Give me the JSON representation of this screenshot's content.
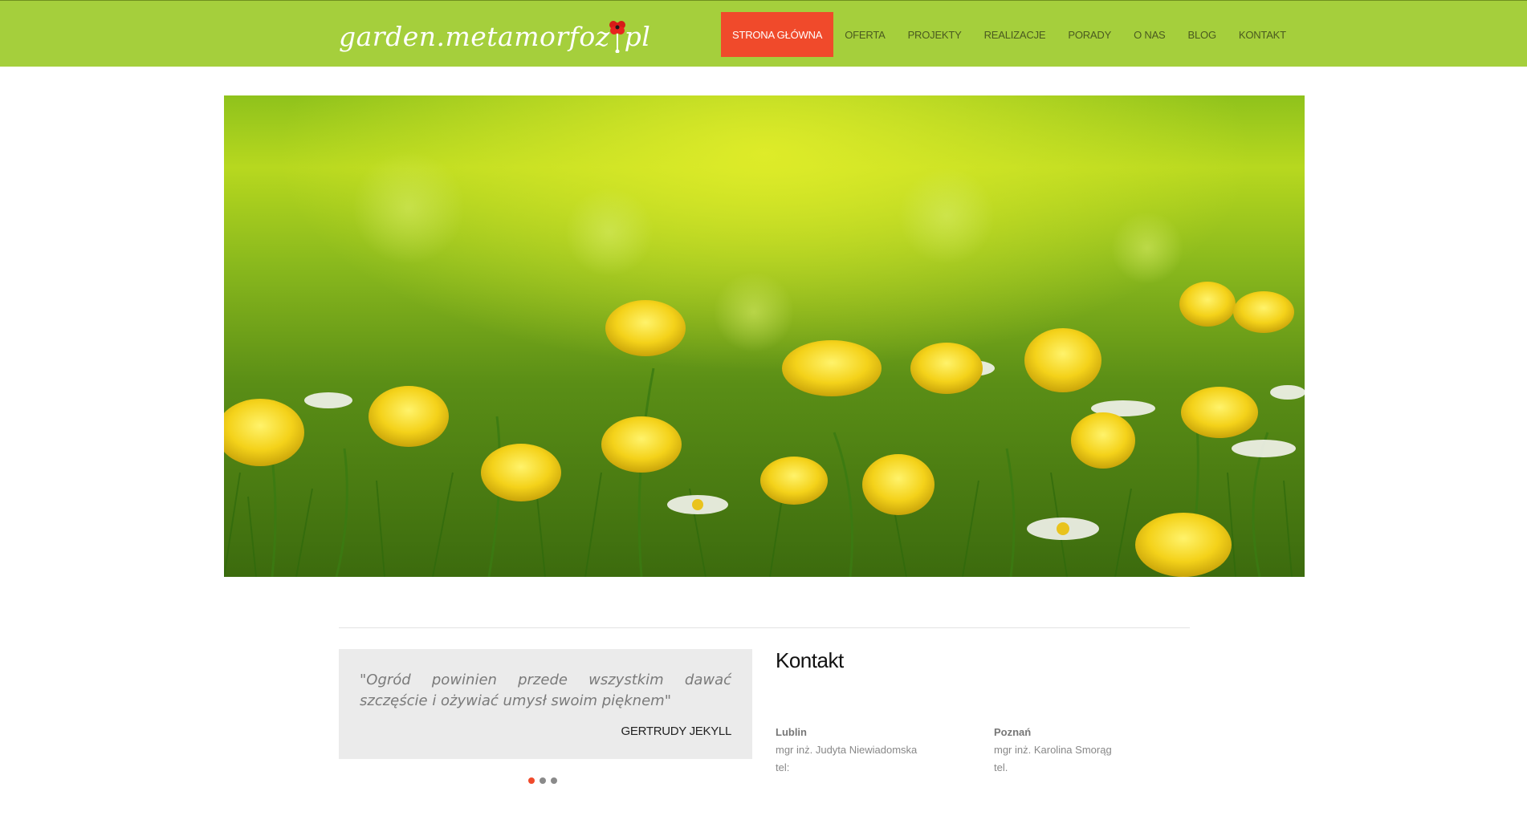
{
  "header": {
    "logo_text_before": "garden.metamorfoz",
    "logo_text_after": "pl",
    "bg_color": "#a5cf3c",
    "accent_color": "#f04a2b"
  },
  "nav": {
    "items": [
      {
        "label": "STRONA GŁÓWNA",
        "active": true
      },
      {
        "label": "OFERTA"
      },
      {
        "label": "PROJEKTY"
      },
      {
        "label": "REALIZACJE"
      },
      {
        "label": "PORADY"
      },
      {
        "label": "O NAS"
      },
      {
        "label": "BLOG"
      },
      {
        "label": "KONTAKT"
      }
    ]
  },
  "quote": {
    "text": "\"Ogród powinien przede wszystkim dawać szczęście i ożywiać umysł swoim pięknem\"",
    "author": "GERTRUDY JEKYLL",
    "slides": 3,
    "active_slide": 1
  },
  "contact": {
    "title": "Kontakt",
    "offices": [
      {
        "city": "Lublin",
        "person": "mgr inż. Judyta Niewiadomska",
        "tel": "tel:"
      },
      {
        "city": "Poznań",
        "person": "mgr inż. Karolina Smorąg",
        "tel": "tel."
      }
    ]
  }
}
